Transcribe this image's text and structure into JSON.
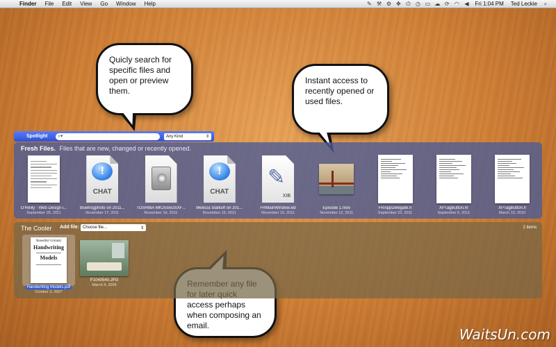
{
  "menubar": {
    "apple": "",
    "items": [
      "Finder",
      "File",
      "Edit",
      "View",
      "Go",
      "Window",
      "Help"
    ],
    "clock": "Fri 1:04 PM",
    "user": "Ted Leckie"
  },
  "callouts": {
    "search": "Quicly search for specific files and open or preview them.",
    "recent": "Instant access to recently opened or used files.",
    "remember": "Remember any file for later quick access perhaps when composing an email."
  },
  "spotlight": {
    "label": "Spotlight",
    "search_value": "",
    "kind": "Any Kind"
  },
  "fresh": {
    "title": "Fresh Files.",
    "subtitle": "Files that are new, changed or recently opened.",
    "files": [
      {
        "name": "O'Reilly - Web Design i...",
        "date": "September 26, 2011",
        "kind": "doc"
      },
      {
        "name": "bluefrogphoto on 2011...",
        "date": "November 17, 2011",
        "kind": "chat"
      },
      {
        "name": "TOSHIBA MK2555GSXF...",
        "date": "November 16, 2011",
        "kind": "disk"
      },
      {
        "name": "Melissa Slatkoff on 201...",
        "date": "November 15, 2011",
        "kind": "chat"
      },
      {
        "name": "FRMainWindow.xib",
        "date": "November 15, 2011",
        "kind": "xib"
      },
      {
        "name": "Episode 1.mov",
        "date": "November 12, 2011",
        "kind": "video"
      },
      {
        "name": "FRAppDelegate.h",
        "date": "September 23, 2011",
        "kind": "code"
      },
      {
        "name": "XPTagButton.m",
        "date": "September 6, 2011",
        "kind": "code"
      },
      {
        "name": "XPTagButton.h",
        "date": "March 10, 2010",
        "kind": "code"
      }
    ],
    "chat_word": "CHAT",
    "xib_tag": "XIB"
  },
  "cooler": {
    "title": "The Cooler",
    "add_label": "Add file:",
    "choose": "Choose file...",
    "count": "2 items",
    "items": [
      {
        "name": "Handwriting Models.pdf",
        "date": "October 3, 2007",
        "cover_author": "Benedikt Gröndal",
        "cover_title_1": "Handwriting",
        "cover_title_2": "Models"
      },
      {
        "name": "P1040540.JPG",
        "date": "March 4, 2009"
      }
    ]
  },
  "watermark": "WaitsUn.com",
  "colors": {
    "spotlight_blue": "#3a5fe0",
    "fresh_panel": "#4e5c96",
    "cooler_panel": "#766648",
    "selection": "#2d5bdb"
  }
}
